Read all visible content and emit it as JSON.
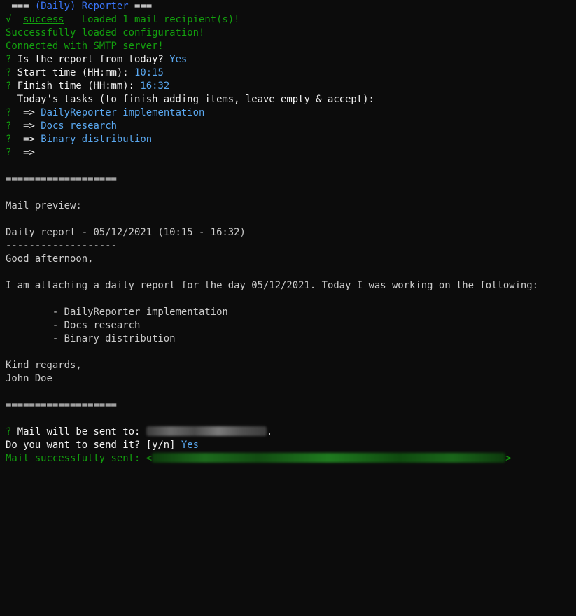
{
  "header": {
    "prefix": " === ",
    "title": "(Daily) Reporter",
    "suffix": " ==="
  },
  "status": {
    "check": "√",
    "success_label": "success",
    "recipients_msg": "Loaded 1 mail recipient(s)!",
    "config_msg": "Successfully loaded configuration!",
    "smtp_msg": "Connected with SMTP server!"
  },
  "prompts": {
    "marker": "?",
    "today_question": "Is the report from today?",
    "today_answer": "Yes",
    "start_question": "Start time (HH:mm):",
    "start_answer": "10:15",
    "finish_question": "Finish time (HH:mm):",
    "finish_answer": "16:32",
    "tasks_hint": "  Today's tasks (to finish adding items, leave empty & accept):",
    "arrow": " =>",
    "tasks": [
      "DailyReporter implementation",
      "Docs research",
      "Binary distribution"
    ]
  },
  "separator": "===================",
  "preview": {
    "heading": "Mail preview:",
    "subject": "Daily report - 05/12/2021 (10:15 - 16:32)",
    "underline": "-------------------",
    "greeting": "Good afternoon,",
    "intro": "I am attaching a daily report for the day 05/12/2021. Today I was working on the following:",
    "items": [
      "        - DailyReporter implementation",
      "        - Docs research",
      "        - Binary distribution"
    ],
    "closing": "Kind regards,",
    "signature": "John Doe"
  },
  "footer": {
    "sent_to_question": "Mail will be sent to:",
    "sent_to_end": ".",
    "send_question": "Do you want to send it? [y/n]",
    "send_answer": "Yes",
    "sent_msg": "Mail successfully sent: <",
    "sent_msg_end": ">"
  },
  "colors": {
    "background": "#0c0c0c",
    "text": "#cccccc",
    "green": "#13a10e",
    "blue": "#3b78ff",
    "answer_blue": "#5aa8f0"
  }
}
